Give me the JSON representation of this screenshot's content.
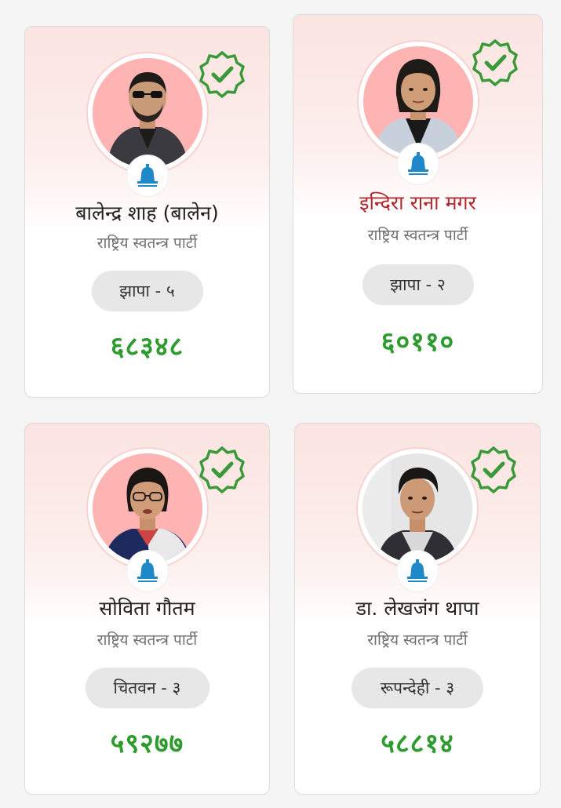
{
  "colors": {
    "winner_votes": "#2e9b2e",
    "verified_badge": "#3a9a3a",
    "party_bell": "#1e88c8",
    "card_gradient_top": "#fbe4e1",
    "highlight_name": "#b3262e"
  },
  "candidates": [
    {
      "name": "बालेन्द्र शाह (बालेन)",
      "party": "राष्ट्रिय स्वतन्त्र पार्टी",
      "constituency": "झापा - ५",
      "votes": "६८३४८",
      "verified_icon": "verified-check-badge-icon",
      "party_icon": "bell-icon"
    },
    {
      "name": "इन्दिरा राना मगर",
      "party": "राष्ट्रिय स्वतन्त्र पार्टी",
      "constituency": "झापा - २",
      "votes": "६०११०",
      "verified_icon": "verified-check-badge-icon",
      "party_icon": "bell-icon"
    },
    {
      "name": "सोविता गौतम",
      "party": "राष्ट्रिय स्वतन्त्र पार्टी",
      "constituency": "चितवन - ३",
      "votes": "५९२७७",
      "verified_icon": "verified-check-badge-icon",
      "party_icon": "bell-icon"
    },
    {
      "name": "डा. लेखजंग थापा",
      "party": "राष्ट्रिय स्वतन्त्र पार्टी",
      "constituency": "रूपन्देही - ३",
      "votes": "५८८१४",
      "verified_icon": "verified-check-badge-icon",
      "party_icon": "bell-icon"
    }
  ]
}
